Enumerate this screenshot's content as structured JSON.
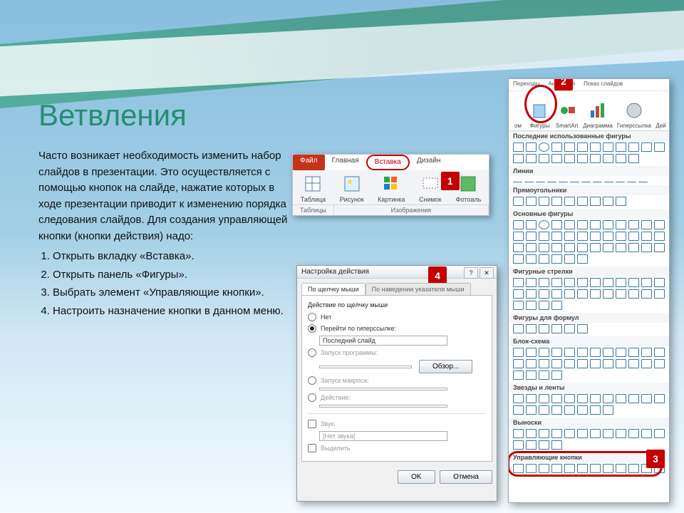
{
  "title": "Ветвления",
  "paragraph": "Часто возникает необходимость изменить набор слайдов в презентации. Это осуществляется с помощью кнопок на слайде, нажатие которых в ходе презентации приводит к изменению порядка следования слайдов. Для создания управляющей кнопки (кнопки действия) надо:",
  "steps": [
    "Открыть вкладку «Вставка».",
    "Открыть панель «Фигуры».",
    "Выбрать элемент «Управляющие кнопки».",
    "Настроить назначение кнопки в данном меню."
  ],
  "ribbon": {
    "tabs": {
      "file": "Файл",
      "home": "Главная",
      "insert": "Вставка",
      "design": "Дизайн"
    },
    "items": [
      "Таблица",
      "Рисунок",
      "Картинка",
      "Снимок",
      "Фотоаль"
    ],
    "groups": [
      "Таблицы",
      "Изображения"
    ]
  },
  "dialog": {
    "title": "Настройка действия",
    "tabs": [
      "По щелчку мыши",
      "По наведении указателя мыши"
    ],
    "section": "Действие по щелчку мыши",
    "opt_none": "Нет",
    "opt_hyper": "Перейти по гиперссылке:",
    "hyper_value": "Последний слайд",
    "opt_run_prog": "Запуск программы:",
    "browse": "Обзор...",
    "opt_macro": "Запуск макроса:",
    "opt_action": "Действие:",
    "sound": "Звук:",
    "sound_value": "[Нет звука]",
    "highlight": "Выделить",
    "ok": "OK",
    "cancel": "Отмена"
  },
  "shapes_top": {
    "tabs": [
      "Переходы",
      "Анимация",
      "Показ слайдов"
    ],
    "items": [
      "ом",
      "Фигуры",
      "SmartArt",
      "Диаграмма",
      "Гиперссылка",
      "Дей"
    ]
  },
  "shape_cats": [
    "Последние использованные фигуры",
    "Линии",
    "Прямоугольники",
    "Основные фигуры",
    "Фигурные стрелки",
    "Фигуры для формул",
    "Блок-схема",
    "Звезды и ленты",
    "Выноски",
    "Управляющие кнопки"
  ],
  "callouts": {
    "one": "1",
    "two": "2",
    "three": "3",
    "four": "4"
  }
}
